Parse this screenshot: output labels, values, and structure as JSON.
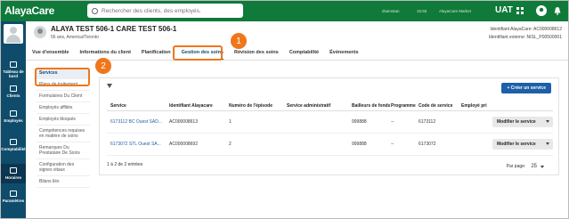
{
  "app": {
    "logo": "AlayaCare"
  },
  "topbar": {
    "search_placeholder": "Rechercher des clients, des employés,",
    "item1": "dsamstan",
    "item2": "15:55",
    "item3": "AlayaCare Market",
    "env": "UAT"
  },
  "sidebar": {
    "items": [
      {
        "label": "Tableau de bord"
      },
      {
        "label": "Clients"
      },
      {
        "label": "Employés"
      },
      {
        "label": "Comptabilité"
      },
      {
        "label": "Horaires"
      },
      {
        "label": "Paramètres"
      }
    ]
  },
  "client": {
    "name": "ALAYA TEST 506-1 CARE TEST 506-1",
    "info": "56 ans, America/Toronto",
    "id_alaya": "Identifiant AlayaCare: AC000008612",
    "id_external": "Identifiant externe: NISL_P00500001"
  },
  "tabs": [
    "Vue d'ensemble",
    "Informations du client",
    "Planification",
    "Gestion des soins",
    "Révision des soins",
    "Comptabilité",
    "Événements"
  ],
  "subnav": [
    "Services",
    "Plans de traitement",
    "Formulaires Du Client",
    "Employés affiliés",
    "Employés bloqués",
    "Compétences requises en matière de soins",
    "Remarques Du Prestataire De Soins",
    "Configuration des signes vitaux",
    "Bilans liés"
  ],
  "panel": {
    "create_label": "Créer un service",
    "headers": [
      "Service",
      "Identifiant Alayacare",
      "Numéro de l'épisode",
      "Service administratif",
      "Bailleurs de fonds",
      "Programme",
      "Code de service",
      "Employé pri"
    ],
    "rows": [
      {
        "service": "6173112 BC Ouest SAD...",
        "id": "AC000008613",
        "episode": "1",
        "admin": "",
        "payer": "999888",
        "program": "--",
        "code": "6173112",
        "action": "Modifier le service"
      },
      {
        "service": "6173072 STL Ouest SA...",
        "id": "AC000008692",
        "episode": "2",
        "admin": "",
        "payer": "999888",
        "program": "--",
        "code": "6173072",
        "action": "Modifier le service"
      }
    ],
    "count": "1 à 2 de 2 entrées",
    "per_page_label": "Par page:",
    "per_page_value": "25"
  },
  "callouts": {
    "one": "1",
    "two": "2"
  },
  "colors": {
    "brand_green": "#0f7a3a",
    "sidebar_navy": "#0f4c6b",
    "primary_blue": "#1d5fa8",
    "callout_orange": "#f0761c"
  }
}
